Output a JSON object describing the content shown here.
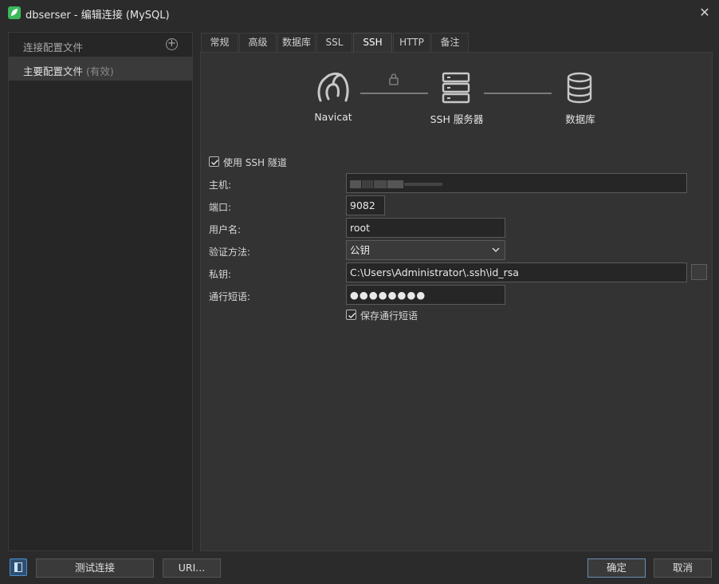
{
  "window": {
    "title": "dbserser - 编辑连接 (MySQL)",
    "close_glyph": "✕",
    "icon": "navicat-leaf-icon"
  },
  "sidebar": {
    "header_label": "连接配置文件",
    "add_glyph": "+",
    "items": [
      {
        "label": "主要配置文件",
        "state": "(有效)"
      }
    ]
  },
  "tabs": [
    {
      "label": "常规"
    },
    {
      "label": "高级"
    },
    {
      "label": "数据库"
    },
    {
      "label": "SSL"
    },
    {
      "label": "SSH",
      "active": true
    },
    {
      "label": "HTTP"
    },
    {
      "label": "备注"
    }
  ],
  "diagram": {
    "client_label": "Navicat",
    "server_label": "SSH 服务器",
    "database_label": "数据库"
  },
  "ssh": {
    "use_tunnel_label": "使用 SSH 隧道",
    "use_tunnel_checked": true,
    "host_label": "主机:",
    "host_value": "",
    "port_label": "端口:",
    "port_value": "9082",
    "username_label": "用户名:",
    "username_value": "root",
    "auth_label": "验证方法:",
    "auth_value": "公钥",
    "private_key_label": "私钥:",
    "private_key_value": "C:\\Users\\Administrator\\.ssh\\id_rsa",
    "passphrase_label": "通行短语:",
    "passphrase_value": "●●●●●●●●",
    "save_passphrase_label": "保存通行短语",
    "save_passphrase_checked": true
  },
  "footer": {
    "test_connection_label": "测试连接",
    "uri_label": "URI...",
    "ok_label": "确定",
    "cancel_label": "取消"
  },
  "colors": {
    "background": "#2b2b2b",
    "panel": "#333333",
    "accent": "#4a8fd6",
    "app_icon": "#3cb85c"
  }
}
